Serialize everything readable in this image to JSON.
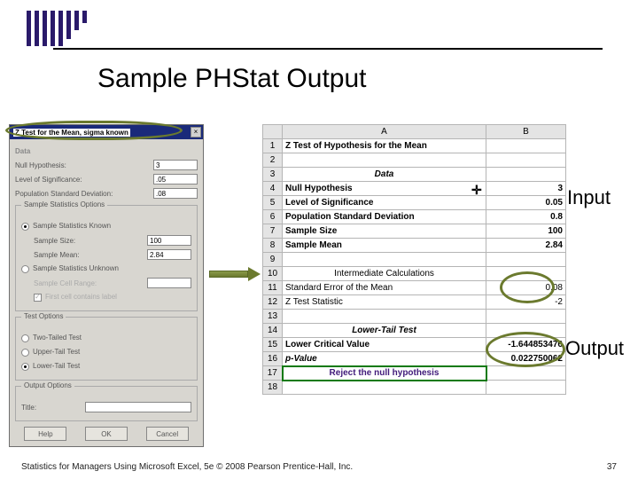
{
  "slide": {
    "title": "Sample PHStat Output",
    "footer_left": "Statistics for Managers Using Microsoft Excel, 5e © 2008 Pearson Prentice-Hall, Inc.",
    "footer_right": "37"
  },
  "annotations": {
    "input": "Input",
    "output": "Output"
  },
  "dialog": {
    "title": "Z Test for the Mean, sigma known",
    "close_glyph": "×",
    "labels": {
      "data": "Data",
      "null_hyp": "Null Hypothesis:",
      "sig": "Level of Significance:",
      "pop_sd": "Population Standard Deviation:",
      "sso": "Sample Statistics Options",
      "known": "Sample Statistics Known",
      "size": "Sample Size:",
      "mean": "Sample Mean:",
      "unknown": "Sample Statistics Unknown",
      "cell_range": "Sample Cell Range:",
      "first_label": "First cell contains label",
      "test_opt": "Test Options",
      "two": "Two-Tailed Test",
      "upper": "Upper-Tail Test",
      "lower": "Lower-Tail Test",
      "out_opt": "Output Options",
      "title": "Title:",
      "help": "Help",
      "ok": "OK",
      "cancel": "Cancel"
    },
    "values": {
      "null_hyp": "3",
      "sig": ".05",
      "pop_sd": ".08",
      "size": "100",
      "mean": "2.84",
      "title": ""
    }
  },
  "sheet": {
    "col_a": "A",
    "col_b": "B",
    "rows": {
      "r1_a": "Z Test of Hypothesis for the Mean",
      "r3_a": "Data",
      "r4_a": "Null Hypothesis",
      "r4_b": "3",
      "r5_a": "Level of Significance",
      "r5_b": "0.05",
      "r6_a": "Population Standard Deviation",
      "r6_b": "0.8",
      "r7_a": "Sample Size",
      "r7_b": "100",
      "r8_a": "Sample Mean",
      "r8_b": "2.84",
      "r10_a": "Intermediate Calculations",
      "r11_a": "Standard Error of the Mean",
      "r11_b": "0.08",
      "r12_a": "Z Test Statistic",
      "r12_b": "-2",
      "r14_a": "Lower-Tail Test",
      "r15_a": "Lower Critical Value",
      "r15_b": "-1.644853476",
      "r16_a": "p-Value",
      "r16_b": "0.022750062",
      "r17_a": "Reject the null hypothesis"
    }
  }
}
